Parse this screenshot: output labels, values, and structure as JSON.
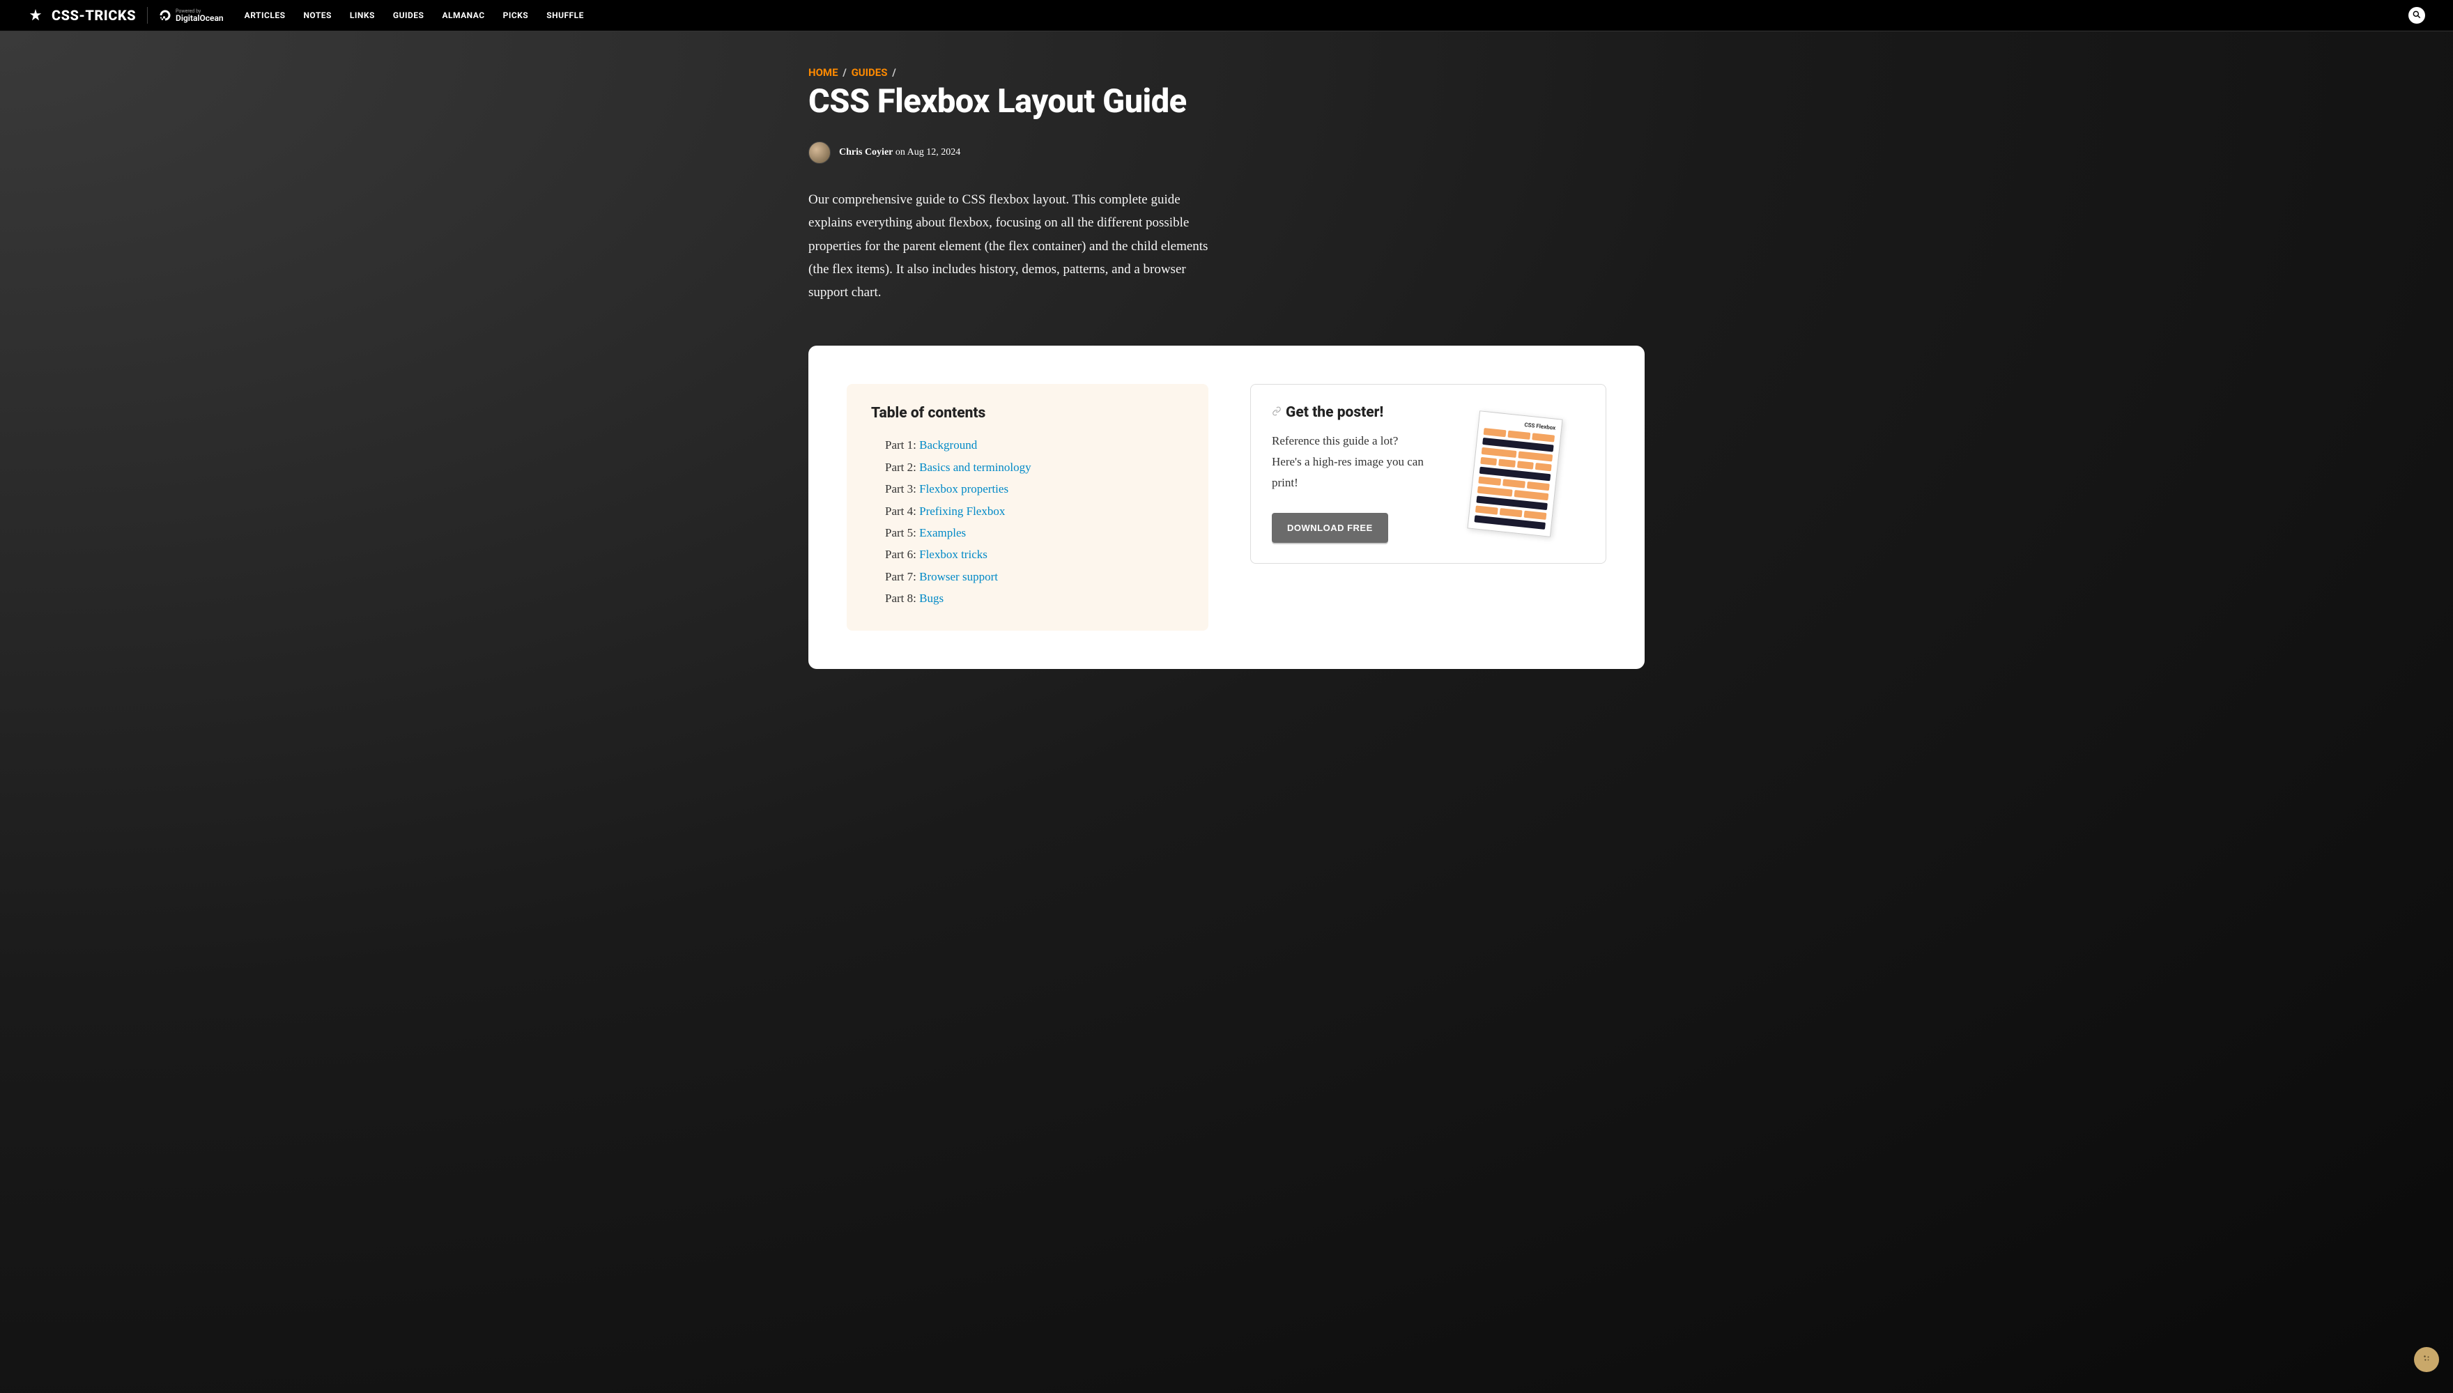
{
  "header": {
    "logo": "CSS-TRICKS",
    "powered_by_label": "Powered by",
    "powered_by_name": "DigitalOcean",
    "nav": [
      "ARTICLES",
      "NOTES",
      "LINKS",
      "GUIDES",
      "ALMANAC",
      "PICKS",
      "SHUFFLE"
    ]
  },
  "breadcrumb": {
    "home": "HOME",
    "guides": "GUIDES"
  },
  "title": "CSS Flexbox Layout Guide",
  "author": {
    "name": "Chris Coyier",
    "date_prefix": " on ",
    "date": "Aug 12, 2024"
  },
  "intro": "Our comprehensive guide to CSS flexbox layout. This complete guide explains everything about flexbox, focusing on all the different possible properties for the parent element (the flex container) and the child elements (the flex items). It also includes history, demos, patterns, and a browser support chart.",
  "toc": {
    "title": "Table of contents",
    "items": [
      {
        "prefix": "Part 1: ",
        "label": "Background"
      },
      {
        "prefix": "Part 2: ",
        "label": "Basics and terminology"
      },
      {
        "prefix": "Part 3: ",
        "label": "Flexbox properties"
      },
      {
        "prefix": "Part 4: ",
        "label": "Prefixing Flexbox"
      },
      {
        "prefix": "Part 5: ",
        "label": "Examples"
      },
      {
        "prefix": "Part 6: ",
        "label": "Flexbox tricks"
      },
      {
        "prefix": "Part 7: ",
        "label": "Browser support"
      },
      {
        "prefix": "Part 8: ",
        "label": "Bugs"
      }
    ]
  },
  "poster": {
    "title": "Get the poster!",
    "text": "Reference this guide a lot? Here's a high-res image you can print!",
    "button": "DOWNLOAD FREE",
    "mock_title": "CSS Flexbox"
  }
}
